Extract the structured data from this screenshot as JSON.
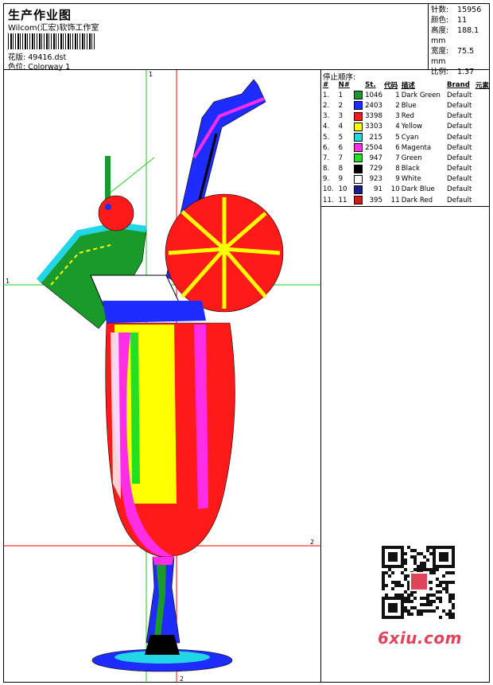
{
  "header": {
    "title": "生产作业图",
    "company": "Wilcom(汇宏)软饰工作室",
    "design_label": "花版:",
    "design_file": "49416.dst",
    "colorway_label": "色位:",
    "colorway": "Colorway 1"
  },
  "stats": {
    "stitches_label": "针数:",
    "stitches": "15956",
    "colors_label": "颜色:",
    "colors": "11",
    "height_label": "高度:",
    "height": "188.1 mm",
    "width_label": "宽度:",
    "width": "75.5 mm",
    "scale_label": "比例:",
    "scale": "1.37"
  },
  "sequence": {
    "title": "停止顺序:",
    "headers": [
      "#",
      "N#",
      "St.",
      "代码",
      "描述",
      "Brand",
      "元素"
    ],
    "rows": [
      {
        "idx": "1.",
        "n": "1",
        "color": "#1a9a2a",
        "st": "1046",
        "code": "1",
        "desc": "Dark Green",
        "brand": "Default"
      },
      {
        "idx": "2.",
        "n": "2",
        "color": "#1f2cff",
        "st": "2403",
        "code": "2",
        "desc": "Blue",
        "brand": "Default"
      },
      {
        "idx": "3.",
        "n": "3",
        "color": "#ff1a1a",
        "st": "3398",
        "code": "3",
        "desc": "Red",
        "brand": "Default"
      },
      {
        "idx": "4.",
        "n": "4",
        "color": "#ffff00",
        "st": "3303",
        "code": "4",
        "desc": "Yellow",
        "brand": "Default"
      },
      {
        "idx": "5.",
        "n": "5",
        "color": "#22d6e6",
        "st": "215",
        "code": "5",
        "desc": "Cyan",
        "brand": "Default"
      },
      {
        "idx": "6.",
        "n": "6",
        "color": "#ff2ee6",
        "st": "2504",
        "code": "6",
        "desc": "Magenta",
        "brand": "Default"
      },
      {
        "idx": "7.",
        "n": "7",
        "color": "#22e022",
        "st": "947",
        "code": "7",
        "desc": "Green",
        "brand": "Default"
      },
      {
        "idx": "8.",
        "n": "8",
        "color": "#000000",
        "st": "729",
        "code": "8",
        "desc": "Black",
        "brand": "Default"
      },
      {
        "idx": "9.",
        "n": "9",
        "color": "#ffffff",
        "st": "923",
        "code": "9",
        "desc": "White",
        "brand": "Default"
      },
      {
        "idx": "10.",
        "n": "10",
        "color": "#1c1c8c",
        "st": "91",
        "code": "10",
        "desc": "Dark Blue",
        "brand": "Default"
      },
      {
        "idx": "11.",
        "n": "11",
        "color": "#d11a1a",
        "st": "395",
        "code": "11",
        "desc": "Dark Red",
        "brand": "Default"
      }
    ]
  },
  "guides": {
    "v1": "1",
    "h1": "1",
    "v2": "2",
    "h2": "2"
  },
  "watermark": {
    "text": "6xiu.com"
  },
  "colors": {
    "guide_green": "#22cc22",
    "guide_red": "#ff0000"
  }
}
